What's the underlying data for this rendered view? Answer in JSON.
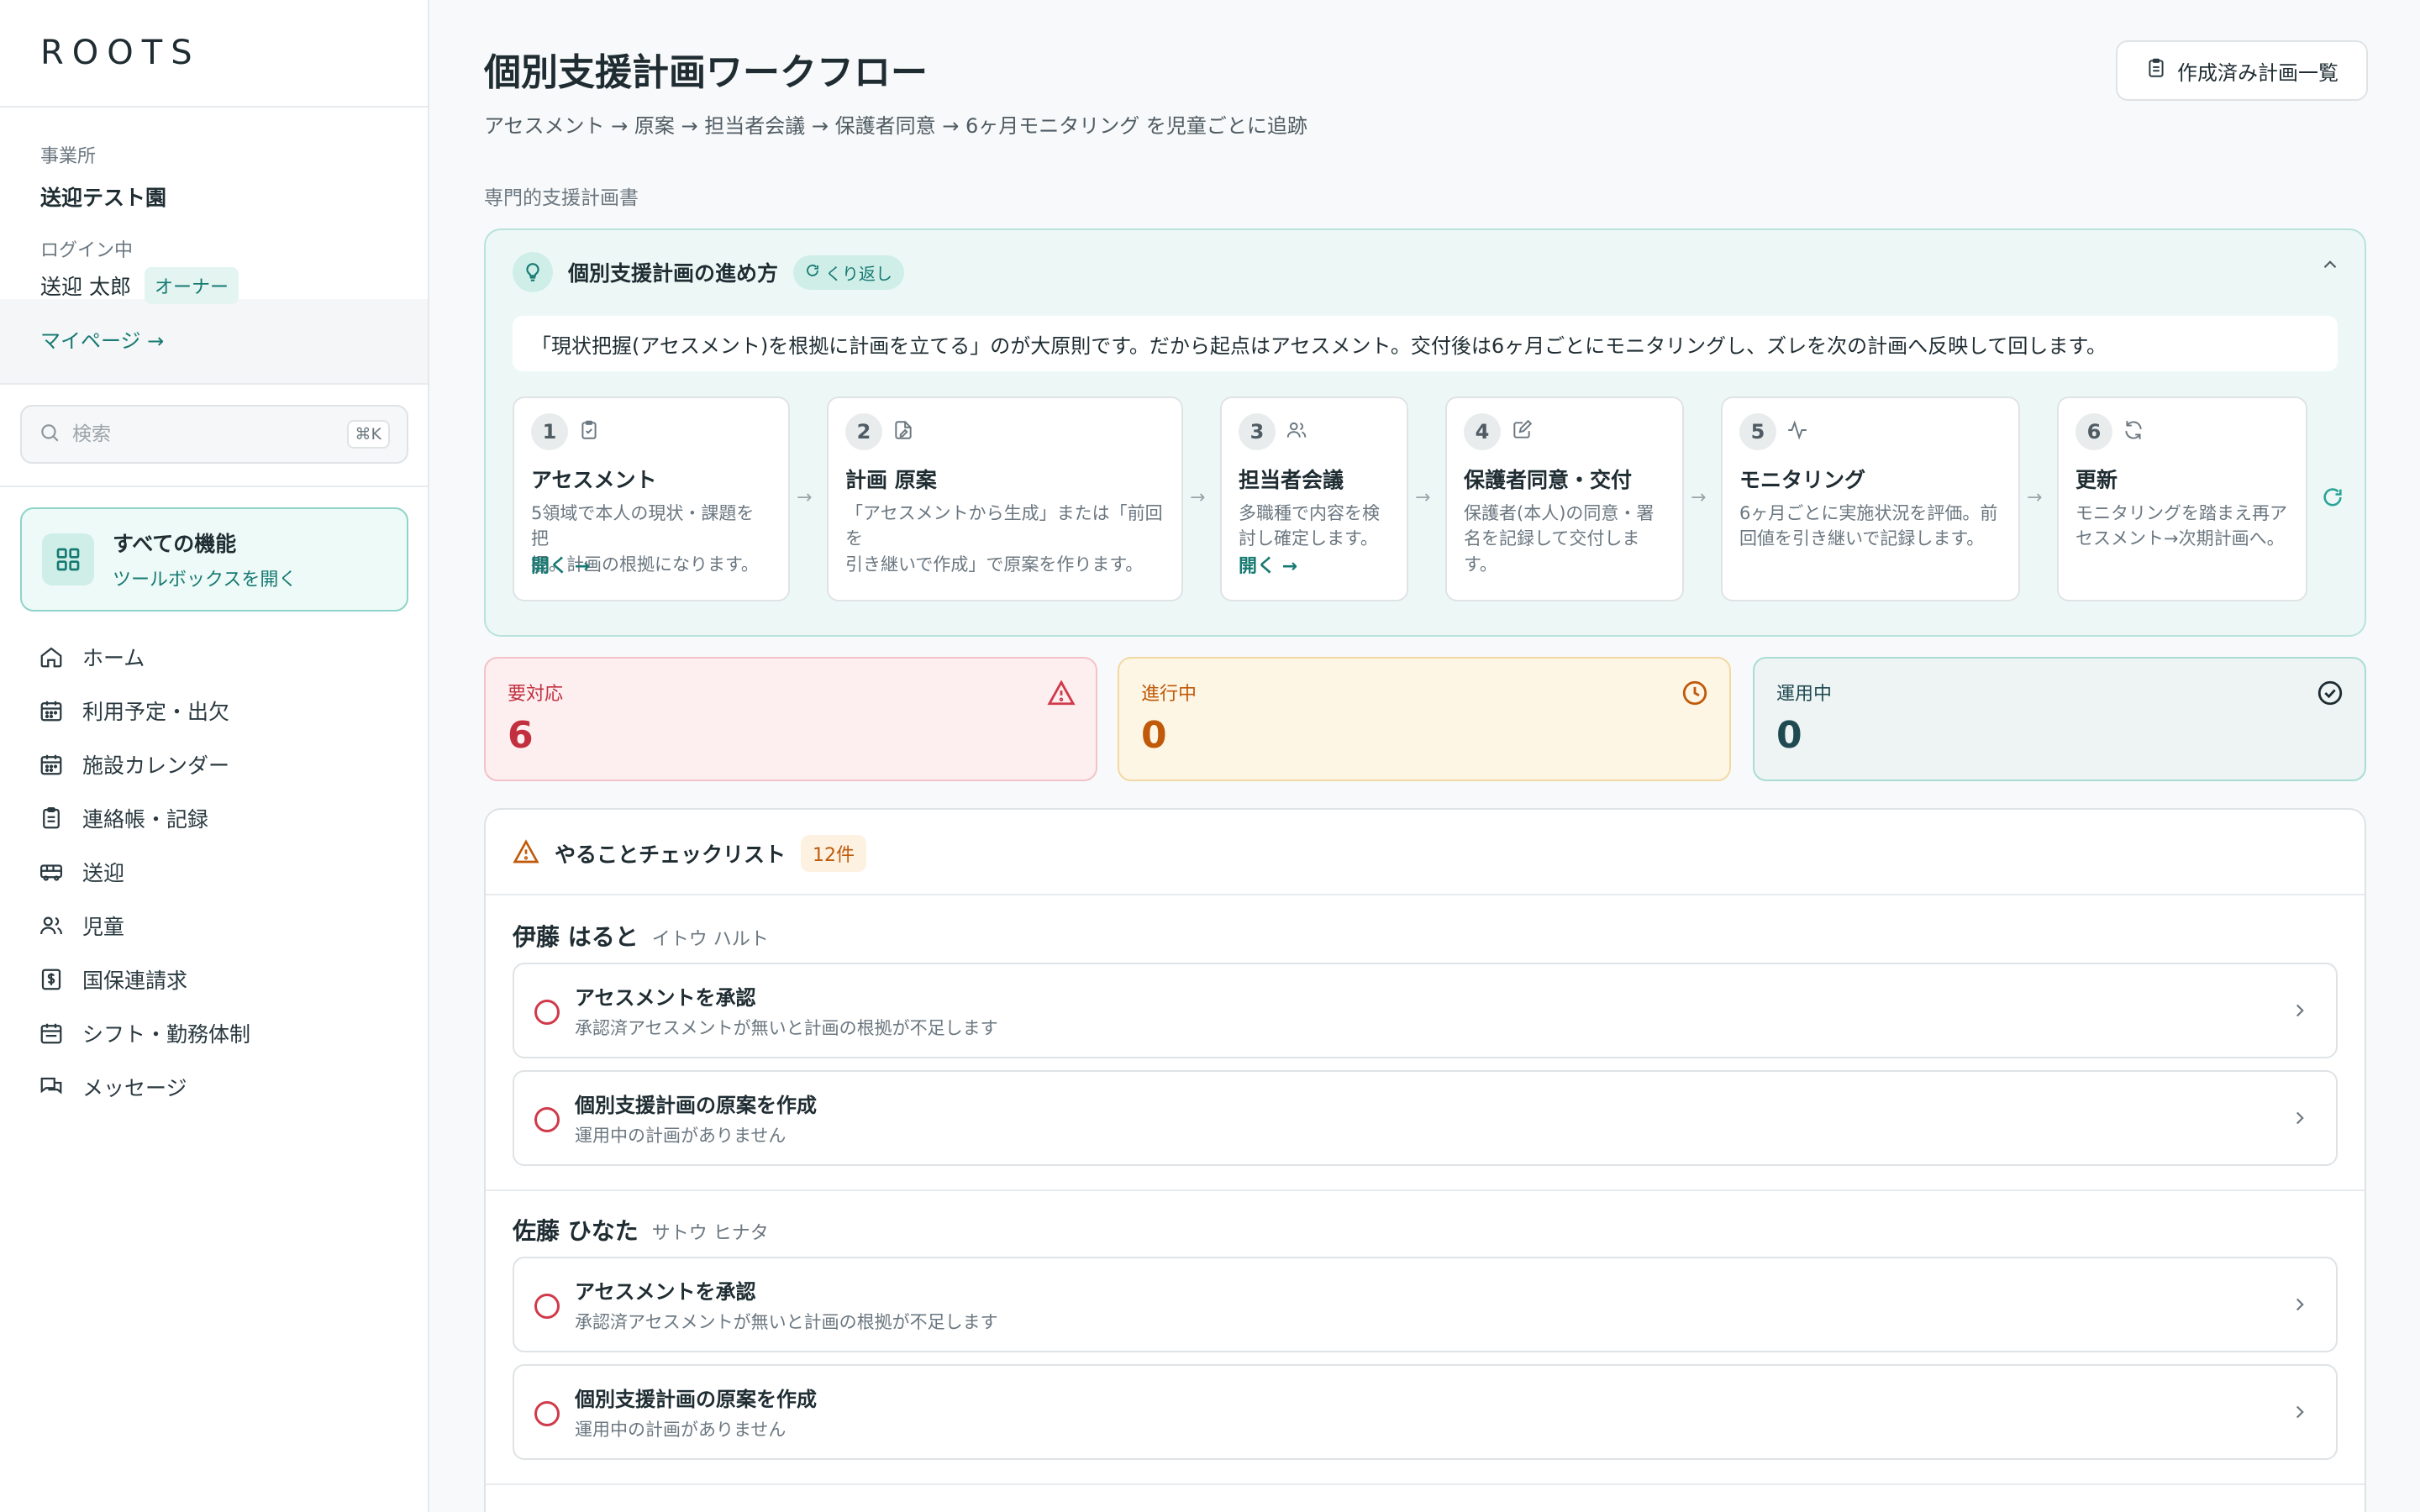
{
  "sidebar": {
    "logo": "ROOTS",
    "office_label": "事業所",
    "office_name": "送迎テスト園",
    "login_label": "ログイン中",
    "user_name": "送迎 太郎",
    "role": "オーナー",
    "mypage": "マイページ →",
    "search_placeholder": "検索",
    "search_shortcut": "⌘K",
    "all_features_title": "すべての機能",
    "all_features_sub": "ツールボックスを開く",
    "nav": [
      {
        "label": "ホーム",
        "icon": "home-icon"
      },
      {
        "label": "利用予定・出欠",
        "icon": "calendar-icon"
      },
      {
        "label": "施設カレンダー",
        "icon": "calendar-icon"
      },
      {
        "label": "連絡帳・記録",
        "icon": "clipboard-icon"
      },
      {
        "label": "送迎",
        "icon": "bus-icon"
      },
      {
        "label": "児童",
        "icon": "users-icon"
      },
      {
        "label": "国保連請求",
        "icon": "invoice-icon"
      },
      {
        "label": "シフト・勤務体制",
        "icon": "calendar-icon"
      },
      {
        "label": "メッセージ",
        "icon": "messages-icon"
      }
    ]
  },
  "main": {
    "title": "個別支援計画ワークフロー",
    "subtitle": "アセスメント → 原案 → 担当者会議 → 保護者同意 → 6ヶ月モニタリング を児童ごとに追跡",
    "list_button": "作成済み計画一覧",
    "section_label": "専門的支援計画書",
    "guide": {
      "title": "個別支援計画の進め方",
      "badge": "くり返し",
      "principle": "「現状把握(アセスメント)を根拠に計画を立てる」のが大原則です。だから起点はアセスメント。交付後は6ヶ月ごとにモニタリングし、ズレを次の計画へ反映して回します。",
      "steps": [
        {
          "num": "1",
          "title": "アセスメント",
          "desc1": "5領域で本人の現状・課題を把",
          "desc2": "握。計画の根拠になります。",
          "open": "開く →",
          "icon": "clipboard-check-icon"
        },
        {
          "num": "2",
          "title": "計画 原案",
          "desc1": "「アセスメントから生成」または「前回を",
          "desc2": "引き継いで作成」で原案を作ります。",
          "open": "",
          "icon": "file-edit-icon"
        },
        {
          "num": "3",
          "title": "担当者会議",
          "desc1": "多職種で内容を検",
          "desc2": "討し確定します。",
          "open": "開く →",
          "icon": "users-icon"
        },
        {
          "num": "4",
          "title": "保護者同意・交付",
          "desc1": "保護者(本人)の同意・署",
          "desc2": "名を記録して交付します。",
          "open": "",
          "icon": "signature-icon"
        },
        {
          "num": "5",
          "title": "モニタリング",
          "desc1": "6ヶ月ごとに実施状況を評価。前",
          "desc2": "回値を引き継いで記録します。",
          "open": "",
          "icon": "activity-icon"
        },
        {
          "num": "6",
          "title": "更新",
          "desc1": "モニタリングを踏まえ再ア",
          "desc2": "セスメント→次期計画へ。",
          "open": "",
          "icon": "refresh-icon"
        }
      ]
    },
    "stats": [
      {
        "label": "要対応",
        "value": "6",
        "color": "#d03a4a"
      },
      {
        "label": "進行中",
        "value": "0",
        "color": "#c05a0a"
      },
      {
        "label": "運用中",
        "value": "0",
        "color": "#1f4a52"
      }
    ],
    "checklist": {
      "title": "やることチェックリスト",
      "count": "12件",
      "children": [
        {
          "name": "伊藤 はると",
          "kana": "イトウ ハルト",
          "tasks": [
            {
              "title": "アセスメントを承認",
              "sub": "承認済アセスメントが無いと計画の根拠が不足します"
            },
            {
              "title": "個別支援計画の原案を作成",
              "sub": "運用中の計画がありません"
            }
          ]
        },
        {
          "name": "佐藤 ひなた",
          "kana": "サトウ ヒナタ",
          "tasks": [
            {
              "title": "アセスメントを承認",
              "sub": "承認済アセスメントが無いと計画の根拠が不足します"
            },
            {
              "title": "個別支援計画の原案を作成",
              "sub": "運用中の計画がありません"
            }
          ]
        }
      ]
    }
  }
}
